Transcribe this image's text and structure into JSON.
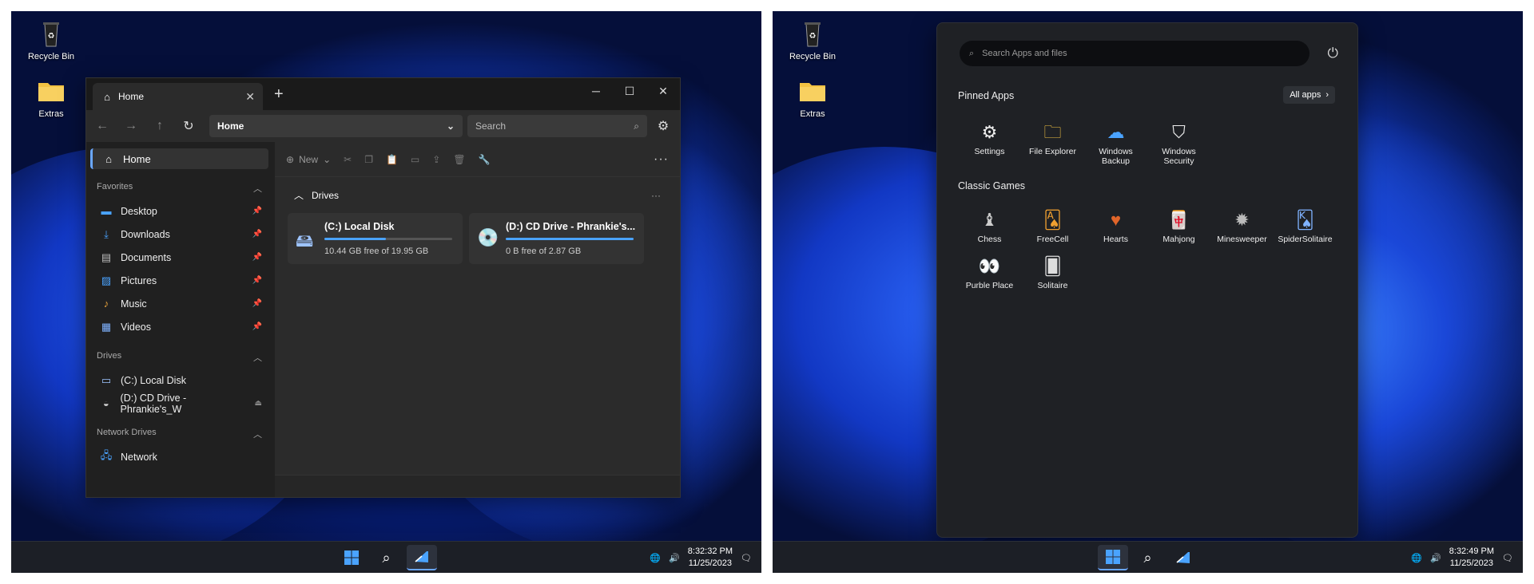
{
  "left_screen": {
    "desktop_icons": [
      {
        "label": "Recycle Bin",
        "icon": "recycle-bin-icon"
      },
      {
        "label": "Extras",
        "icon": "folder-icon"
      }
    ],
    "explorer": {
      "tab_title": "Home",
      "address": "Home",
      "search_placeholder": "Search",
      "command_new": "New",
      "sidebar": {
        "home": "Home",
        "favorites_header": "Favorites",
        "favorites": [
          "Desktop",
          "Downloads",
          "Documents",
          "Pictures",
          "Music",
          "Videos"
        ],
        "drives_header": "Drives",
        "drives": [
          "(C:) Local Disk",
          "(D:) CD Drive - Phrankie's_W"
        ],
        "network_header": "Network Drives",
        "network": [
          "Network"
        ]
      },
      "drives_section": "Drives",
      "drive_cards": [
        {
          "name": "(C:) Local Disk",
          "free": "10.44 GB free of 19.95 GB",
          "used_fraction": 0.48
        },
        {
          "name": "(D:) CD Drive - Phrankie's...",
          "free": "0 B free of 2.87 GB",
          "used_fraction": 1.0
        }
      ]
    },
    "clock": {
      "time": "8:32:32 PM",
      "date": "11/25/2023"
    }
  },
  "right_screen": {
    "desktop_icons": [
      {
        "label": "Recycle Bin",
        "icon": "recycle-bin-icon"
      },
      {
        "label": "Extras",
        "icon": "folder-icon"
      }
    ],
    "start_menu": {
      "search_placeholder": "Search Apps and files",
      "pinned_header": "Pinned Apps",
      "all_apps_label": "All apps",
      "pinned_apps": [
        {
          "label": "Settings",
          "icon": "gear-icon"
        },
        {
          "label": "File Explorer",
          "icon": "folder-icon"
        },
        {
          "label": "Windows Backup",
          "icon": "cloud-upload-icon"
        },
        {
          "label": "Windows Security",
          "icon": "shield-icon"
        }
      ],
      "games_header": "Classic Games",
      "games": [
        {
          "label": "Chess",
          "icon": "chess-icon"
        },
        {
          "label": "FreeCell",
          "icon": "freecell-icon"
        },
        {
          "label": "Hearts",
          "icon": "hearts-icon"
        },
        {
          "label": "Mahjong",
          "icon": "mahjong-icon"
        },
        {
          "label": "Minesweeper",
          "icon": "mine-icon"
        },
        {
          "label": "SpiderSolitaire",
          "icon": "spider-icon"
        },
        {
          "label": "Purble Place",
          "icon": "purble-icon"
        },
        {
          "label": "Solitaire",
          "icon": "cards-icon"
        }
      ]
    },
    "clock": {
      "time": "8:32:49 PM",
      "date": "11/25/2023"
    }
  },
  "colors": {
    "accent": "#4aa3ff",
    "taskbar": "#1c1f26",
    "window": "#202020"
  }
}
